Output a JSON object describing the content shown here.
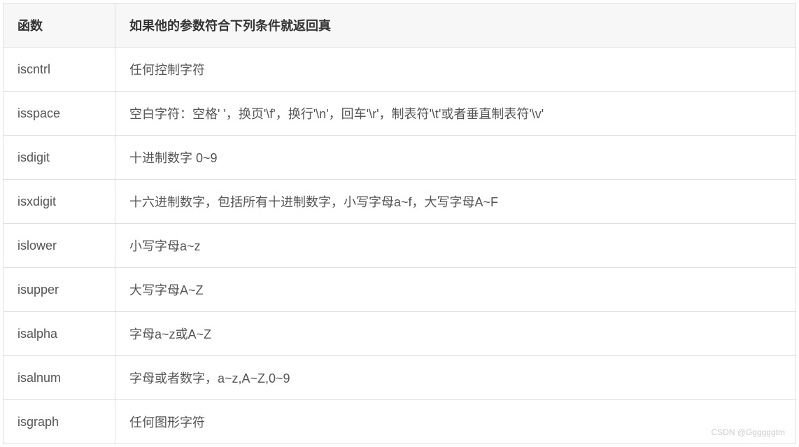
{
  "table": {
    "headers": {
      "func": "函数",
      "desc": "如果他的参数符合下列条件就返回真"
    },
    "rows": [
      {
        "func": "iscntrl",
        "desc": "任何控制字符"
      },
      {
        "func": "isspace",
        "desc": "空白字符：空格' '，换页'\\f'，换行'\\n'，回车'\\r'，制表符'\\t'或者垂直制表符'\\v'"
      },
      {
        "func": "isdigit",
        "desc": "十进制数字 0~9"
      },
      {
        "func": "isxdigit",
        "desc": "十六进制数字，包括所有十进制数字，小写字母a~f，大写字母A~F"
      },
      {
        "func": "islower",
        "desc": "小写字母a~z"
      },
      {
        "func": "isupper",
        "desc": "大写字母A~Z"
      },
      {
        "func": "isalpha",
        "desc": "字母a~z或A~Z"
      },
      {
        "func": "isalnum",
        "desc": "字母或者数字，a~z,A~Z,0~9"
      },
      {
        "func": "isgraph",
        "desc": "任何图形字符"
      }
    ]
  },
  "watermark": "CSDN @Ggggggtm"
}
